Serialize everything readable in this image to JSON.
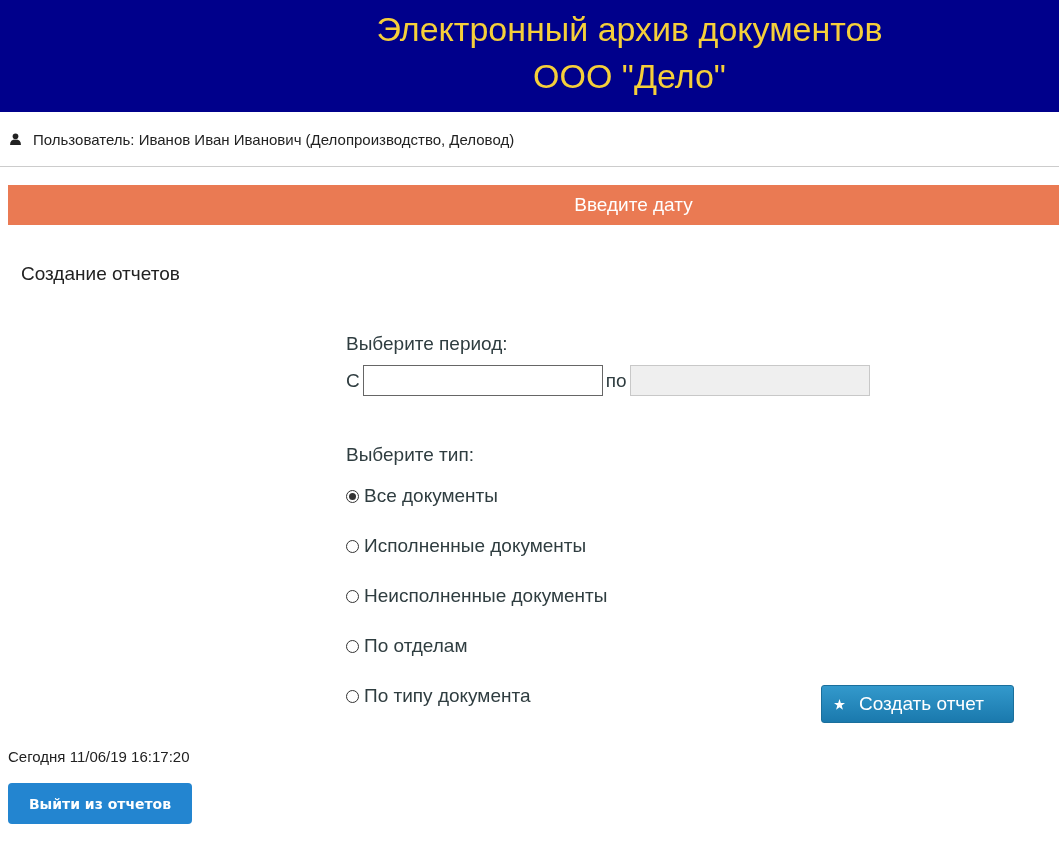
{
  "header": {
    "title_lines": [
      "Электронный архив документов",
      "ООО \"Дело\""
    ]
  },
  "user_line": "Пользователь: Иванов Иван Иванович (Делопроизводство, Деловод)",
  "banner": "Введите дату",
  "section_title": "Создание отчетов",
  "period": {
    "label": "Выберите период:",
    "from_label": "С",
    "from_field": {
      "disabled": false
    },
    "to_label": "по",
    "to_field": {
      "disabled": true
    }
  },
  "type": {
    "label": "Выберите тип:",
    "options": [
      {
        "label": "Все документы",
        "selected": true
      },
      {
        "label": "Исполненные документы",
        "selected": false
      },
      {
        "label": "Неисполненные документы",
        "selected": false
      },
      {
        "label": "По отделам",
        "selected": false
      },
      {
        "label": "По типу документа",
        "selected": false
      }
    ]
  },
  "create_button": "Создать отчет",
  "today": "Сегодня 11/06/19 16:17:20",
  "exit_button": "Выйти из отчетов"
}
